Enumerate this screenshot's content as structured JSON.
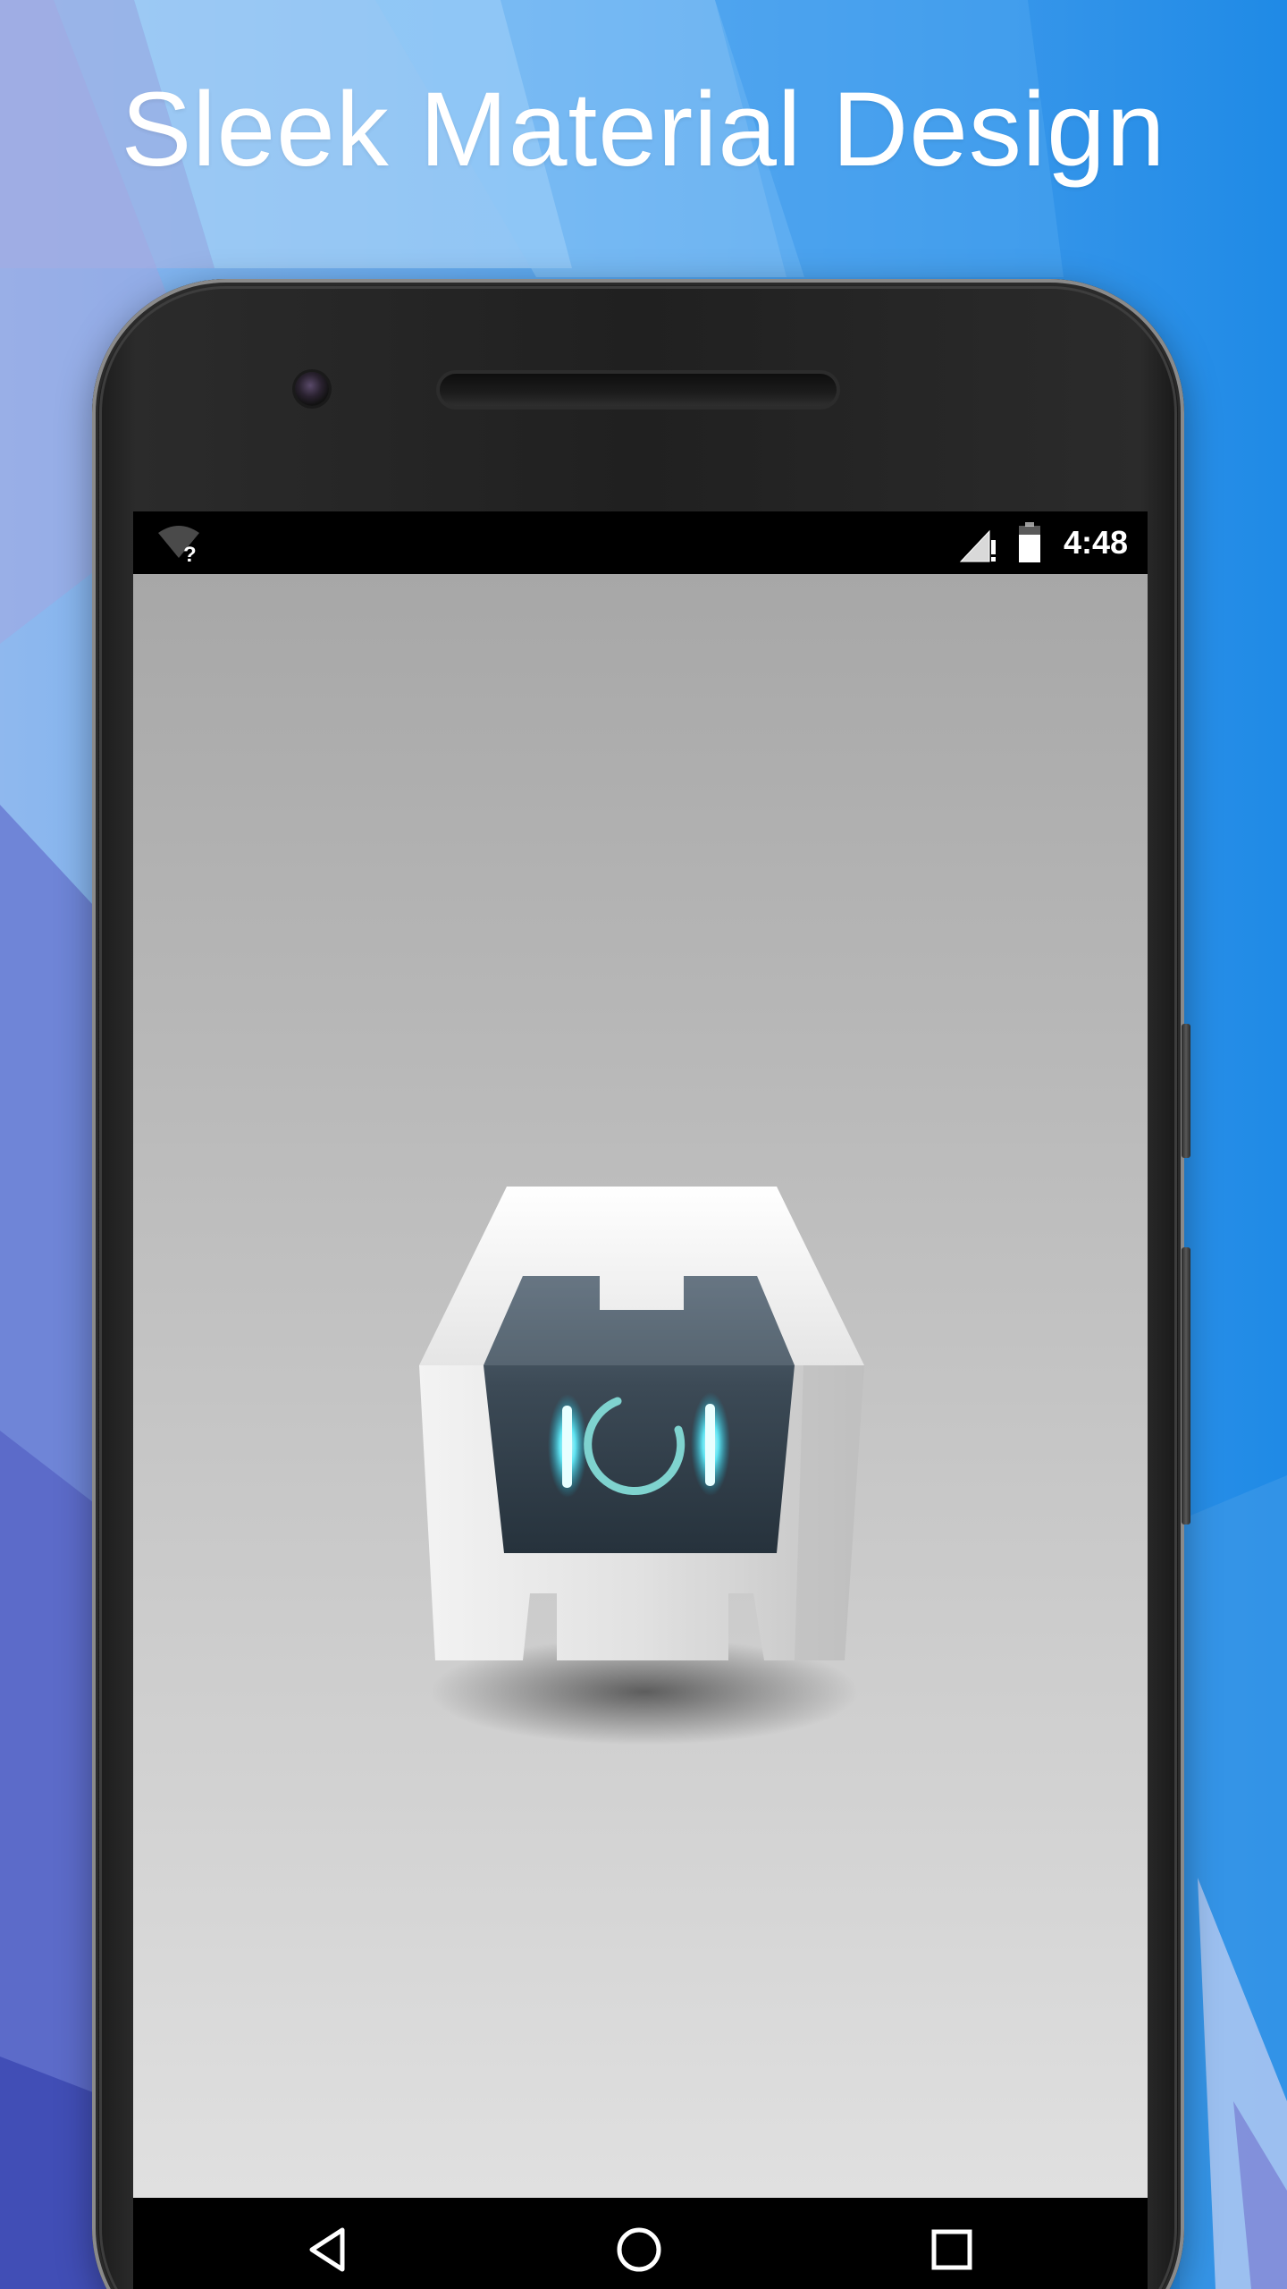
{
  "headline": "Sleek Material Design",
  "status_bar": {
    "time": "4:48",
    "icons": [
      "wifi-unknown-icon",
      "signal-icon",
      "battery-icon"
    ]
  },
  "screen": {
    "content": "app splash logo",
    "logo_icon": "cordova-logo-icon"
  },
  "nav_bar": {
    "buttons": [
      "back-icon",
      "home-icon",
      "recents-icon"
    ]
  },
  "colors": {
    "background_blue": "#2b8ee6",
    "phone_body": "#222222",
    "screen_top": "#a7a7a7",
    "screen_bottom": "#e0e0e0",
    "logo_accent": "#5fd8e8"
  }
}
